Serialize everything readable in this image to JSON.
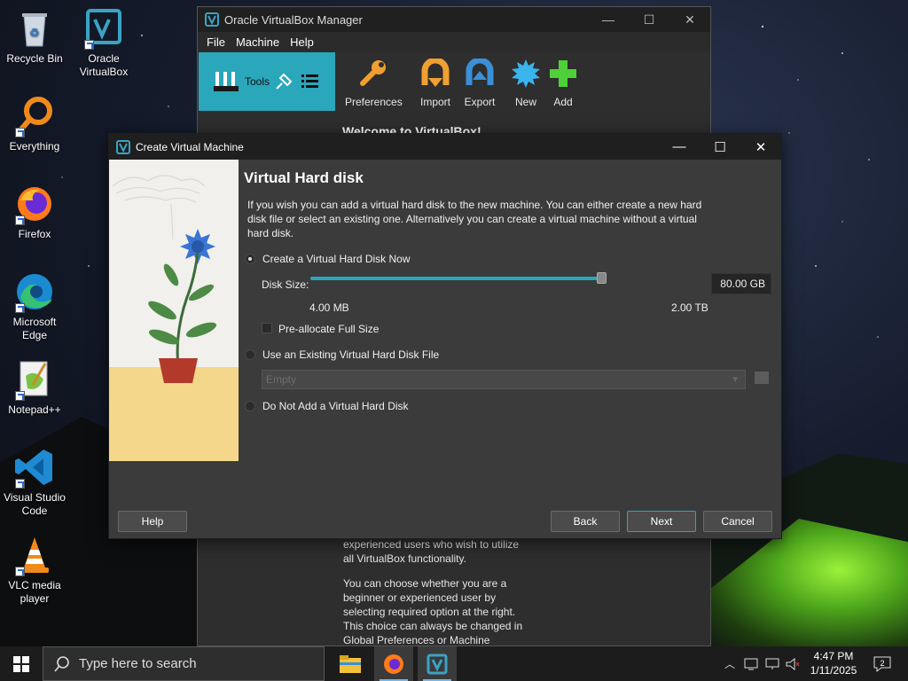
{
  "desktop": {
    "icons": [
      {
        "label": "Recycle Bin"
      },
      {
        "label": "Oracle VirtualBox"
      },
      {
        "label": "Everything"
      },
      {
        "label": "Firefox"
      },
      {
        "label": "Microsoft Edge"
      },
      {
        "label": "Notepad++"
      },
      {
        "label": "Visual Studio Code"
      },
      {
        "label": "VLC media player"
      }
    ]
  },
  "manager": {
    "title": "Oracle VirtualBox Manager",
    "menu": [
      "File",
      "Machine",
      "Help"
    ],
    "tools_label": "Tools",
    "toolbar": [
      "Preferences",
      "Import",
      "Export",
      "New",
      "Add"
    ],
    "welcome": "Welcome to VirtualBox!",
    "text1": "experienced users who wish to utilize all VirtualBox functionality.",
    "text2": "You can choose whether you are a beginner or experienced user by selecting required option at the right. This choice can always be changed in Global Preferences or Machine"
  },
  "dialog": {
    "title": "Create Virtual Machine",
    "heading": "Virtual Hard disk",
    "description": "If you wish you can add a virtual hard disk to the new machine. You can either create a new hard disk file or select an existing one. Alternatively you can create a virtual machine without a virtual hard disk.",
    "option_create": "Create a Virtual Hard Disk Now",
    "disk_size_label": "Disk Size:",
    "disk_size_value": "80.00 GB",
    "slider_fraction": 0.995,
    "min_label": "4.00 MB",
    "max_label": "2.00 TB",
    "preallocate_label": "Pre-allocate Full Size",
    "option_existing": "Use an Existing Virtual Hard Disk File",
    "existing_combo": "Empty",
    "option_none": "Do Not Add a Virtual Hard Disk",
    "selected_option": "create",
    "buttons": {
      "help": "Help",
      "back": "Back",
      "next": "Next",
      "cancel": "Cancel"
    }
  },
  "taskbar": {
    "search_placeholder": "Type here to search",
    "time": "4:47 PM",
    "date": "1/11/2025",
    "notification_count": "2"
  },
  "colors": {
    "accent": "#2aa7ba",
    "dialog_bg": "#3b3b3b"
  }
}
